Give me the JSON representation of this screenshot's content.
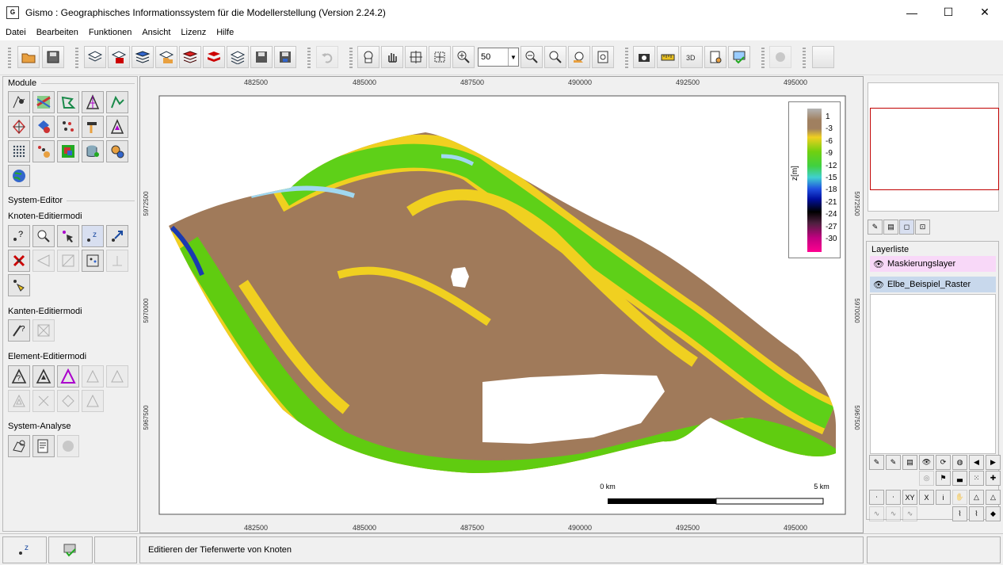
{
  "window": {
    "app_icon": "G",
    "title": "Gismo : Geographisches Informationssystem für die Modellerstellung (Version 2.24.2)",
    "minimize": "—",
    "maximize": "☐",
    "close": "✕"
  },
  "menu": [
    "Datei",
    "Bearbeiten",
    "Funktionen",
    "Ansicht",
    "Lizenz",
    "Hilfe"
  ],
  "toolbar": {
    "zoom_value": "50",
    "zoom_dropdown": "▼"
  },
  "left_panel": {
    "module_label": "Module",
    "system_editor_label": "System-Editor",
    "knoten_label": "Knoten-Editiermodi",
    "kanten_label": "Kanten-Editiermodi",
    "element_label": "Element-Editiermodi",
    "analyse_label": "System-Analyse"
  },
  "map": {
    "x_ticks": [
      "482500",
      "485000",
      "487500",
      "490000",
      "492500",
      "495000"
    ],
    "y_ticks_left": [
      "5972500",
      "5970000",
      "5967500"
    ],
    "y_ticks_right": [
      "5972500",
      "5970000",
      "5967500"
    ],
    "scale_start": "0 km",
    "scale_end": "5 km",
    "legend_title": "z[m]",
    "legend_values": [
      "1",
      "-3",
      "-6",
      "-9",
      "-12",
      "-15",
      "-18",
      "-21",
      "-24",
      "-27",
      "-30"
    ]
  },
  "right_panel": {
    "layer_title": "Layerliste",
    "layers": [
      "Maskierungslayer",
      "Elbe_Beispiel_Raster"
    ],
    "layer_colors": [
      "#f8d8f8",
      "#c8d8ec"
    ],
    "tool_icons": [
      "XY",
      "X",
      "i"
    ]
  },
  "status": {
    "message": "Editieren der Tiefenwerte von Knoten"
  }
}
